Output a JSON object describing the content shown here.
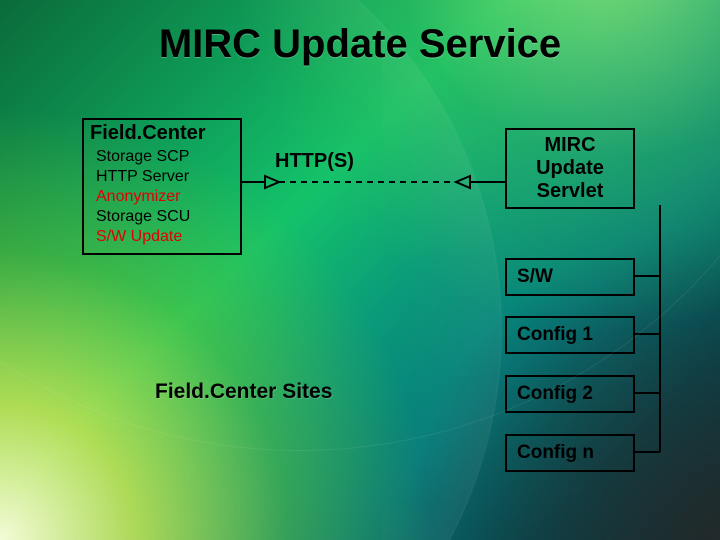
{
  "title": "MIRC Update Service",
  "fieldcenter": {
    "header": "Field.Center",
    "items": [
      {
        "text": "Storage SCP",
        "highlight": false
      },
      {
        "text": "HTTP Server",
        "highlight": false
      },
      {
        "text": "Anonymizer",
        "highlight": true
      },
      {
        "text": "Storage SCU",
        "highlight": false
      },
      {
        "text": "S/W Update",
        "highlight": true
      }
    ]
  },
  "http_label": "HTTP(S)",
  "mirc_box": {
    "line1": "MIRC",
    "line2": "Update",
    "line3": "Servlet"
  },
  "boxes": {
    "sw": "S/W",
    "config1": "Config 1",
    "config2": "Config 2",
    "confign": "Config n"
  },
  "sites_label": "Field.Center Sites",
  "chart_data": {
    "type": "diagram",
    "title": "MIRC Update Service",
    "nodes": [
      {
        "id": "fieldcenter",
        "label": "Field.Center",
        "components": [
          "Storage SCP",
          "HTTP Server",
          "Anonymizer",
          "Storage SCU",
          "S/W Update"
        ]
      },
      {
        "id": "mirc",
        "label": "MIRC Update Servlet"
      },
      {
        "id": "sw",
        "label": "S/W"
      },
      {
        "id": "config1",
        "label": "Config 1"
      },
      {
        "id": "config2",
        "label": "Config 2"
      },
      {
        "id": "confign",
        "label": "Config n"
      }
    ],
    "edges": [
      {
        "from": "fieldcenter",
        "to": "mirc",
        "label": "HTTP(S)",
        "bidirectional": true
      },
      {
        "from": "mirc",
        "to": "sw"
      },
      {
        "from": "mirc",
        "to": "config1"
      },
      {
        "from": "mirc",
        "to": "config2"
      },
      {
        "from": "mirc",
        "to": "confign"
      }
    ],
    "annotations": [
      {
        "text": "Field.Center Sites"
      }
    ]
  }
}
